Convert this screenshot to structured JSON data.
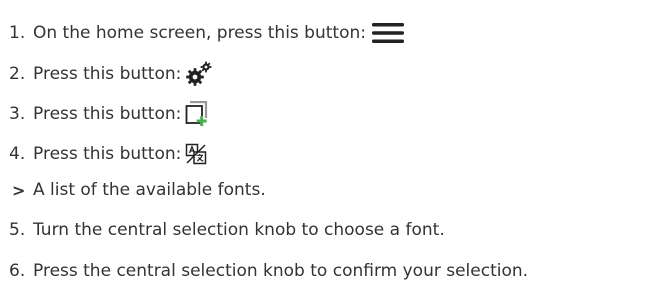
{
  "steps": [
    {
      "number": "1.",
      "text": "On the home screen, press this button:",
      "icon": "menu-icon"
    },
    {
      "number": "2.",
      "text": "Press this button:",
      "icon": "settings-icon"
    },
    {
      "number": "3.",
      "text": "Press this button:",
      "icon": "add-page-icon"
    },
    {
      "number": "4.",
      "text": "Press this button:",
      "icon": "language-icon"
    },
    {
      "number": ">",
      "text": "A list of the available fonts."
    },
    {
      "number": "5.",
      "text": "Turn the central selection knob to choose a font."
    },
    {
      "number": "6.",
      "text": "Press the central selection knob to confirm your selection."
    }
  ],
  "colors": {
    "text": "#333333",
    "icon": "#222222",
    "accent_green": "#4caf50",
    "icon_gray": "#999999"
  }
}
